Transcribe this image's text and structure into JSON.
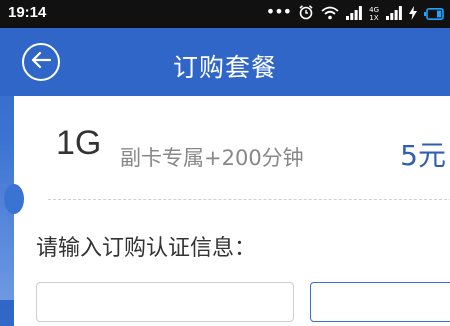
{
  "status_bar": {
    "time": "19:14",
    "overflow_dots": "•••",
    "network_top": "4G",
    "network_bottom": "1X"
  },
  "header": {
    "title": "订购套餐"
  },
  "plan": {
    "size": "1G",
    "description": "副卡专属+200分钟",
    "price": "5元"
  },
  "auth": {
    "label": "请输入订购认证信息："
  },
  "colors": {
    "header_blue": "#2f66c7",
    "price_blue": "#2f5fae",
    "input_focus_border": "#3b6fd0"
  }
}
